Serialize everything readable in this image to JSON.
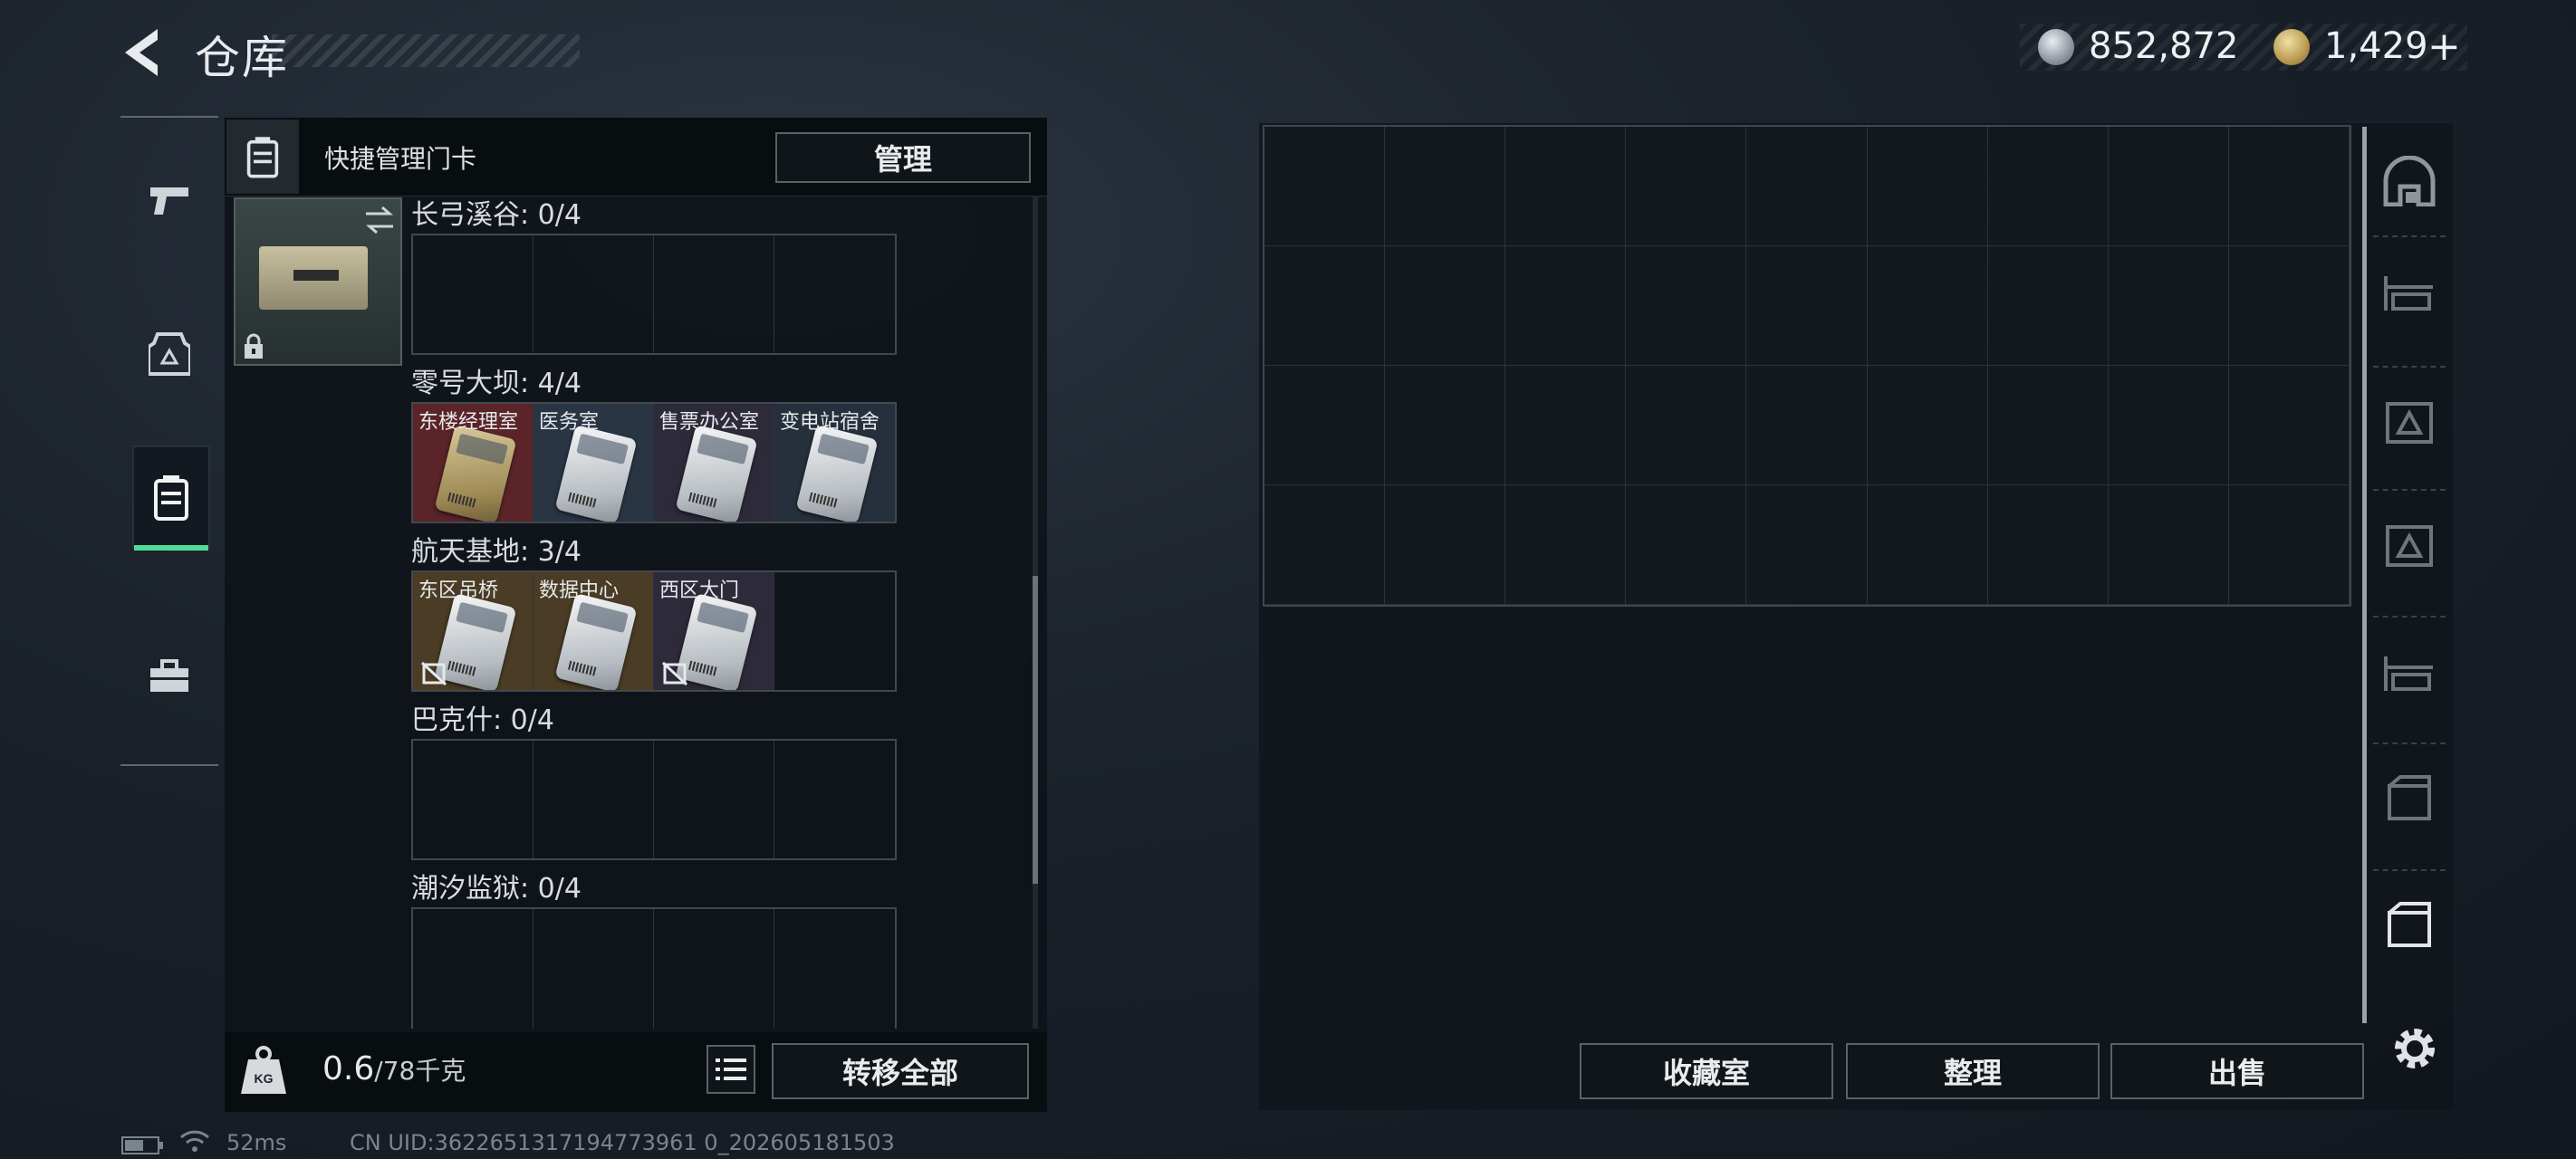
{
  "header": {
    "title": "仓库",
    "silver": "852,872",
    "gold": "1,429",
    "gold_plus": "+"
  },
  "nav": {
    "items": [
      {
        "name": "weapons",
        "icon": "pistol-icon"
      },
      {
        "name": "equipment",
        "icon": "helmet-vest-icon"
      },
      {
        "name": "keycards",
        "icon": "keycard-holder-icon",
        "active": true
      },
      {
        "name": "toolbox",
        "icon": "toolbox-icon"
      }
    ]
  },
  "keycard_panel": {
    "title": "快捷管理门卡",
    "manage_label": "管理",
    "sections": [
      {
        "label": "长弓溪谷: 0/4",
        "cards": []
      },
      {
        "label": "零号大坝: 4/4",
        "cards": [
          {
            "name": "东楼经理室",
            "style": "gold",
            "bg": "#5a2428"
          },
          {
            "name": "医务室",
            "style": "silver",
            "bg": "#2a3544"
          },
          {
            "name": "售票办公室",
            "style": "silver",
            "bg": "#2d2a3a"
          },
          {
            "name": "变电站宿舍",
            "style": "silver",
            "bg": "#26303c"
          }
        ]
      },
      {
        "label": "航天基地: 3/4",
        "cards": [
          {
            "name": "东区吊桥",
            "style": "silver",
            "bg": "#4a3c25",
            "disabled": true
          },
          {
            "name": "数据中心",
            "style": "silver",
            "bg": "#4a3c25"
          },
          {
            "name": "西区大门",
            "style": "silver",
            "bg": "#2d2a3a",
            "disabled": true
          }
        ]
      },
      {
        "label": "巴克什: 0/4",
        "cards": []
      },
      {
        "label": "潮汐监狱: 0/4",
        "cards": []
      }
    ],
    "weight_value": "0.6",
    "weight_capacity": "/78千克",
    "transfer_label": "转移全部"
  },
  "stash": {
    "columns": 9,
    "rows": 4,
    "buttons": {
      "collection": "收藏室",
      "organize": "整理",
      "sell": "出售"
    }
  },
  "status_bar": {
    "ping": "52ms",
    "uid": "CN UID:3622651317194773961 0_202605181503"
  },
  "colors": {
    "active_accent": "#4ddc9a",
    "panel_bg": "#0e1319",
    "button_border": "#5a6168"
  }
}
